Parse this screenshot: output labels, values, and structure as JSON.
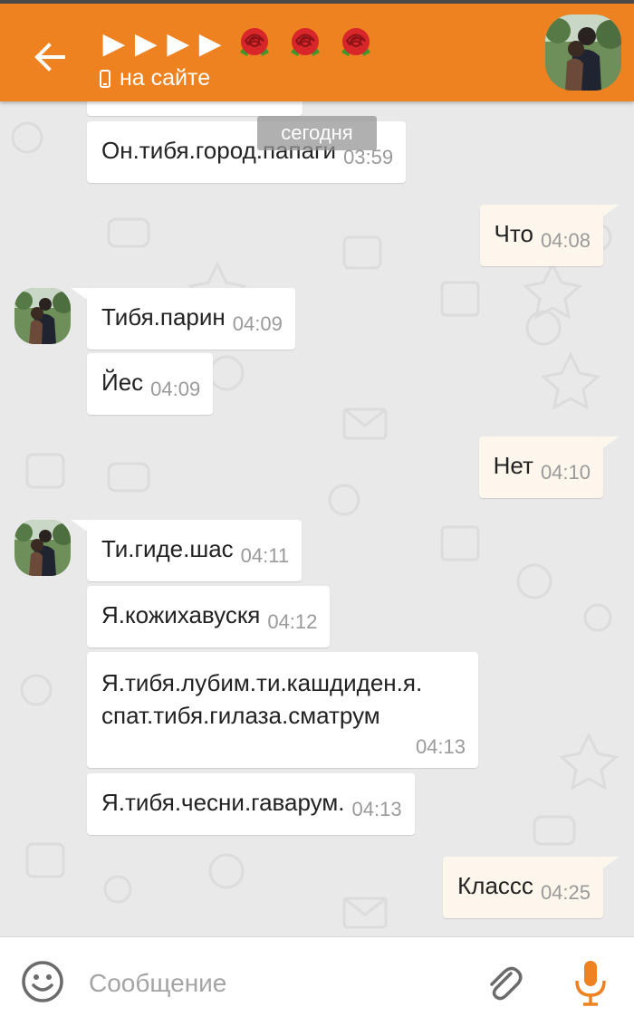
{
  "header": {
    "title": "▶ ▶ ▶ ▶",
    "status": "на сайте",
    "accent_color": "#ee8220",
    "back_icon": "arrow-left-icon",
    "rose_icons": [
      "rose-icon",
      "rose-icon",
      "rose-icon"
    ]
  },
  "chat": {
    "date_separator": "сегодня",
    "messages": [
      {
        "text": "Он.тибя.город.папаги",
        "time": "03:59",
        "direction": "in"
      },
      {
        "text": "Что",
        "time": "04:08",
        "direction": "out"
      },
      {
        "text": "Тибя.парин",
        "time": "04:09",
        "direction": "in"
      },
      {
        "text": "Йес",
        "time": "04:09",
        "direction": "in"
      },
      {
        "text": "Нет",
        "time": "04:10",
        "direction": "out"
      },
      {
        "text": "Ти.гиде.шас",
        "time": "04:11",
        "direction": "in"
      },
      {
        "text": "Я.кожихавускя",
        "time": "04:12",
        "direction": "in"
      },
      {
        "text_line1": "Я.тибя.лубим.ти.кашдиден.я.",
        "text_line2": "спат.тибя.гилаза.сматрум",
        "time": "04:13",
        "direction": "in"
      },
      {
        "text": "Я.тибя.чесни.гаварум.",
        "time": "04:13",
        "direction": "in"
      },
      {
        "text": "Классс",
        "time": "04:25",
        "direction": "out"
      }
    ]
  },
  "composer": {
    "placeholder": "Сообщение",
    "value": "",
    "icons": [
      "smile-icon",
      "paperclip-icon",
      "microphone-icon"
    ],
    "mic_color": "#ee8220"
  }
}
